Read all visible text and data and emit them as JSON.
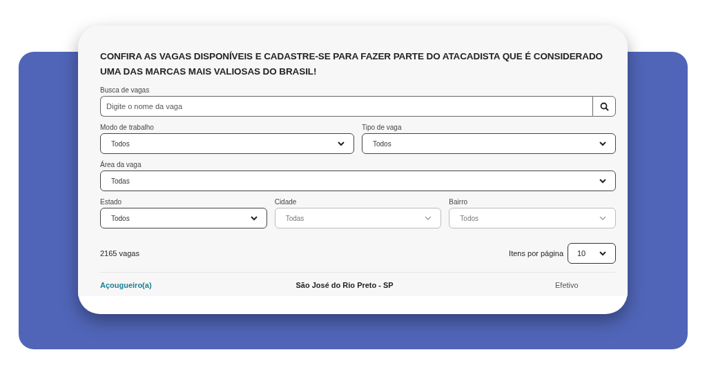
{
  "heading": "CONFIRA AS VAGAS DISPONÍVEIS E CADASTRE-SE PARA FAZER PARTE DO ATACADISTA QUE É CONSIDERADO UMA DAS MARCAS MAIS VALIOSAS DO BRASIL!",
  "filter_rows": [
    {
      "fields": [
        {
          "kind": "search",
          "label": "Busca de vagas",
          "placeholder": "Digite o nome da vaga"
        }
      ]
    },
    {
      "fields": [
        {
          "kind": "select",
          "label": "Modo de trabalho",
          "value": "Todos",
          "disabled": false
        },
        {
          "kind": "select",
          "label": "Tipo de vaga",
          "value": "Todos",
          "disabled": false
        }
      ]
    },
    {
      "fields": [
        {
          "kind": "select",
          "label": "Área da vaga",
          "value": "Todas",
          "disabled": false
        }
      ]
    },
    {
      "fields": [
        {
          "kind": "select",
          "label": "Estado",
          "value": "Todos",
          "disabled": false
        },
        {
          "kind": "select",
          "label": "Cidade",
          "value": "Todas",
          "disabled": true
        },
        {
          "kind": "select",
          "label": "Bairro",
          "value": "Todos",
          "disabled": true
        }
      ]
    }
  ],
  "count": "2165 vagas",
  "per_page": {
    "label": "Itens por página",
    "value": "10"
  },
  "jobs": [
    {
      "title": "Açougueiro(a)",
      "location": "São José do Rio Preto - SP",
      "type": "Efetivo"
    }
  ]
}
